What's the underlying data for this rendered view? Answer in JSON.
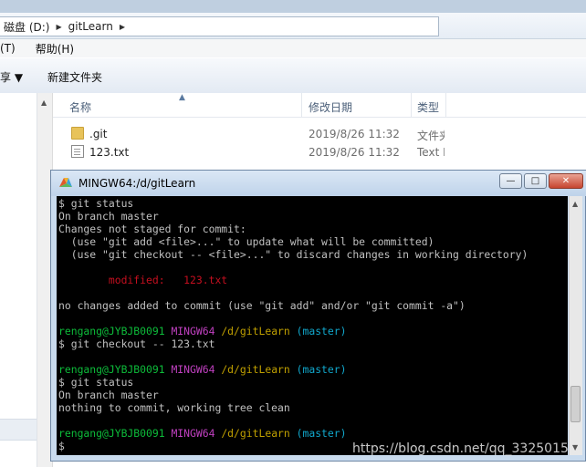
{
  "explorer": {
    "breadcrumb": [
      "磁盘 (D:)",
      "gitLearn"
    ],
    "menu": [
      "(T)",
      "帮助(H)"
    ],
    "toolbar": {
      "share": "享 ▼",
      "new_folder": "新建文件夹"
    },
    "columns": {
      "name": "名称",
      "date": "修改日期",
      "type": "类型"
    },
    "files": [
      {
        "name": ".git",
        "date": "2019/8/26 11:32",
        "type": "文件夹",
        "icon": "folder-icon"
      },
      {
        "name": "123.txt",
        "date": "2019/8/26 11:32",
        "type": "Text D",
        "icon": "text-file-icon"
      }
    ]
  },
  "terminal": {
    "title": "MINGW64:/d/gitLearn",
    "buttons": {
      "minimize": "—",
      "maximize": "□",
      "close": "✕"
    },
    "lines": [
      [
        {
          "t": "$ git status"
        }
      ],
      [
        {
          "t": "On branch master"
        }
      ],
      [
        {
          "t": "Changes not staged for commit:"
        }
      ],
      [
        {
          "t": "  (use \"git add <file>...\" to update what will be committed)"
        }
      ],
      [
        {
          "t": "  (use \"git checkout -- <file>...\" to discard changes in working directory)"
        }
      ],
      [
        {
          "t": ""
        }
      ],
      [
        {
          "t": "        modified:   123.txt",
          "c": "red"
        }
      ],
      [
        {
          "t": ""
        }
      ],
      [
        {
          "t": "no changes added to commit (use \"git add\" and/or \"git commit -a\")"
        }
      ],
      [
        {
          "t": ""
        }
      ],
      [
        {
          "t": "rengang@JYBJB0091",
          "c": "green"
        },
        {
          "t": " "
        },
        {
          "t": "MINGW64",
          "c": "mag"
        },
        {
          "t": " "
        },
        {
          "t": "/d/gitLearn",
          "c": "yel"
        },
        {
          "t": " "
        },
        {
          "t": "(master)",
          "c": "cyan"
        }
      ],
      [
        {
          "t": "$ git checkout -- 123.txt"
        }
      ],
      [
        {
          "t": ""
        }
      ],
      [
        {
          "t": "rengang@JYBJB0091",
          "c": "green"
        },
        {
          "t": " "
        },
        {
          "t": "MINGW64",
          "c": "mag"
        },
        {
          "t": " "
        },
        {
          "t": "/d/gitLearn",
          "c": "yel"
        },
        {
          "t": " "
        },
        {
          "t": "(master)",
          "c": "cyan"
        }
      ],
      [
        {
          "t": "$ git status"
        }
      ],
      [
        {
          "t": "On branch master"
        }
      ],
      [
        {
          "t": "nothing to commit, working tree clean"
        }
      ],
      [
        {
          "t": ""
        }
      ],
      [
        {
          "t": "rengang@JYBJB0091",
          "c": "green"
        },
        {
          "t": " "
        },
        {
          "t": "MINGW64",
          "c": "mag"
        },
        {
          "t": " "
        },
        {
          "t": "/d/gitLearn",
          "c": "yel"
        },
        {
          "t": " "
        },
        {
          "t": "(master)",
          "c": "cyan"
        }
      ],
      [
        {
          "t": "$"
        }
      ]
    ]
  },
  "watermark": "https://blog.csdn.net/qq_3325015",
  "colors": {
    "prompt_user": "#0dbc3a",
    "prompt_mingw": "#c040c0",
    "prompt_path": "#c0a000",
    "prompt_branch": "#11a8cd",
    "modified": "#c50f1f"
  }
}
